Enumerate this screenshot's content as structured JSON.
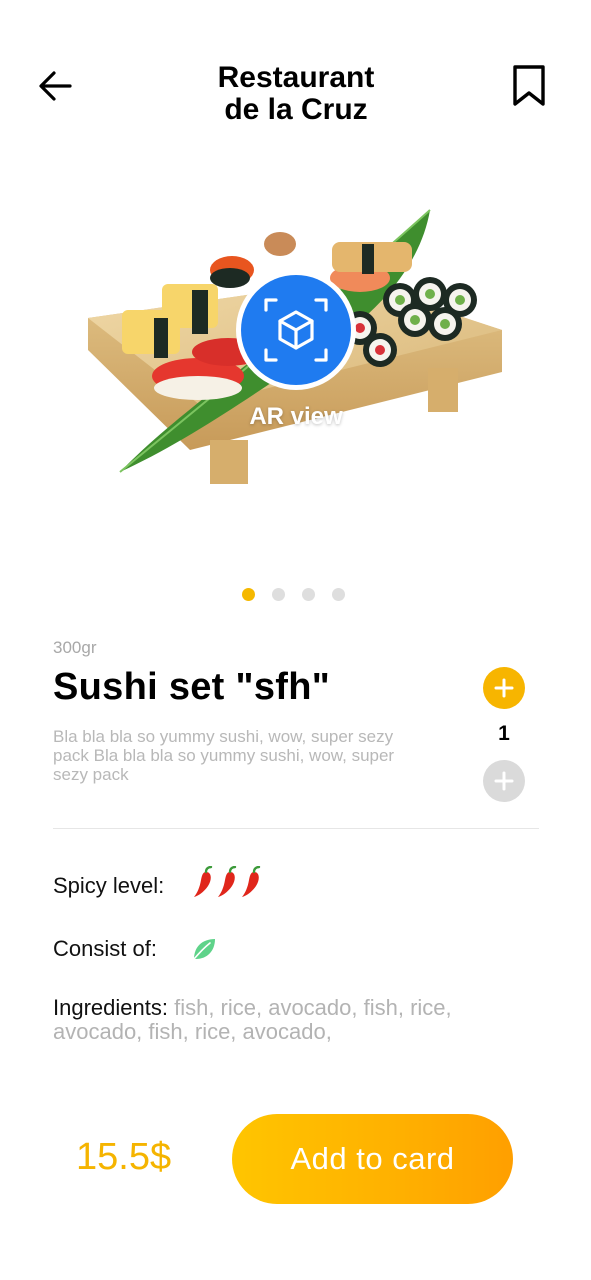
{
  "header": {
    "title_line1": "Restaurant",
    "title_line2": "de la Cruz",
    "back_icon": "arrow-left-icon",
    "bookmark_icon": "bookmark-icon"
  },
  "hero": {
    "ar_label": "AR view",
    "ar_icon": "cube-scan-icon",
    "image": "sushi-set-photo"
  },
  "carousel": {
    "total": 4,
    "active_index": 0
  },
  "product": {
    "weight": "300gr",
    "name": "Sushi set \"sfh\"",
    "description": "Bla bla bla so yummy sushi, wow, super sezy pack Bla bla bla so yummy sushi, wow, super sezy pack",
    "quantity": "1"
  },
  "details": {
    "spicy_label": "Spicy level:",
    "spicy_level": 3,
    "consist_label": "Consist of:",
    "consist_icon": "leaf-icon",
    "ingredients_label": "Ingredients:",
    "ingredients_value": " fish, rice, avocado, fish, rice, avocado, fish, rice, avocado,"
  },
  "footer": {
    "price": "15.5$",
    "add_button_label": "Add to card"
  },
  "colors": {
    "accent": "#f7b500",
    "price": "#f5b400",
    "muted_text": "#b8b8b8",
    "chili": "#e0261b",
    "leaf": "#5fd38a"
  }
}
